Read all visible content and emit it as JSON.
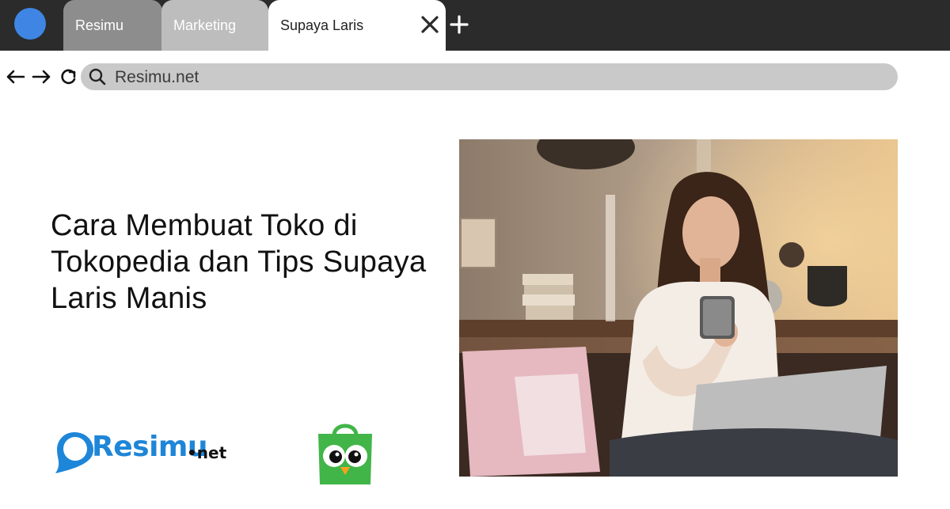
{
  "browser": {
    "tabs": [
      {
        "label": "Resimu"
      },
      {
        "label": "Marketing"
      },
      {
        "label": "Supaya Laris"
      }
    ],
    "address_bar": {
      "url": "Resimu.net"
    },
    "icons": {
      "profile": "profile-dot-icon",
      "close_tab": "close-icon",
      "new_tab": "plus-icon",
      "back": "arrow-left-icon",
      "forward": "arrow-right-icon",
      "reload": "reload-icon",
      "search": "search-icon"
    }
  },
  "content": {
    "headline": "Cara Membuat Toko di Tokopedia dan Tips Supaya Laris Manis",
    "brand": {
      "name": "Resimu",
      "suffix": "net"
    },
    "image": "woman-using-smartphone-and-laptop"
  },
  "colors": {
    "profile": "#3f86e4",
    "tabbar": "#2b2b2b",
    "brand_blue": "#1e86d8",
    "tokopedia_green": "#42b549"
  }
}
